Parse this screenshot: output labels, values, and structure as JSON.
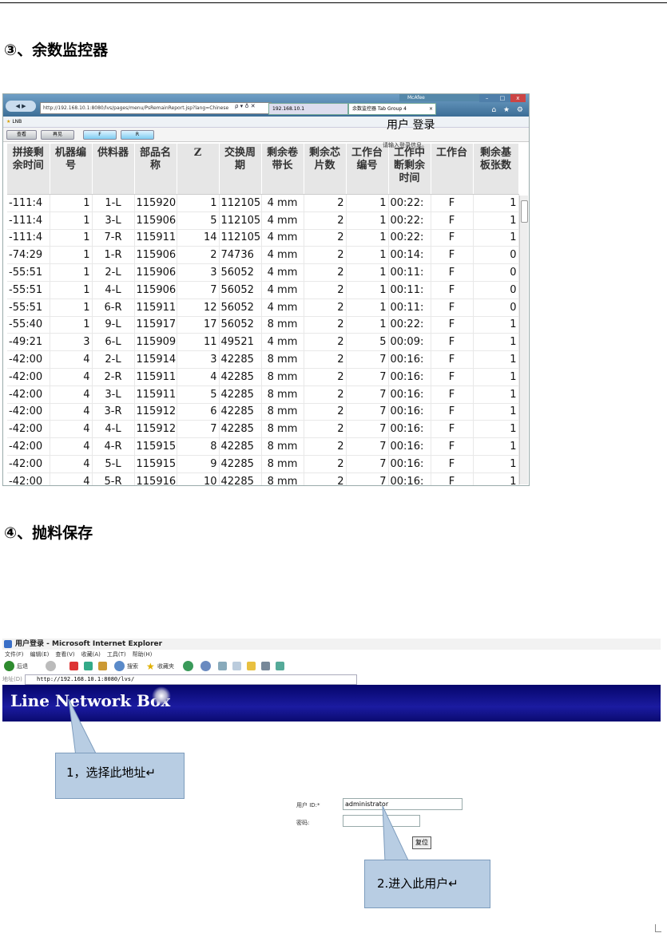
{
  "section3": {
    "heading": "③、余数监控器"
  },
  "section4": {
    "heading": "④、抛料保存"
  },
  "ie9": {
    "nav_label": "◀ ▶",
    "address": "http://192.168.10.1:8080/lvs/pages/menu/PsRemainReport.jsp?lang=Chinese",
    "address_controls": "ρ ▾ ♁ ✕",
    "tab1": "192.168.10.1",
    "tab2": "余数监控器 Tab Group 4",
    "tab_close": "×",
    "user": "McAfee",
    "favorites": "LNB",
    "icons": "⌂ ★ ⚙",
    "win_controls": {
      "min": "–",
      "max": "□",
      "close": "x"
    },
    "buttons": [
      "查看",
      "再见",
      "F",
      "R"
    ],
    "table": {
      "headers": [
        [
          "拼接剩",
          "余时间"
        ],
        [
          "机器编",
          "号"
        ],
        [
          "供料器"
        ],
        [
          "部品名",
          "称"
        ],
        [
          "Z"
        ],
        [
          "交换周",
          "期"
        ],
        [
          "剩余卷",
          "带长"
        ],
        [
          "剩余芯",
          "片数"
        ],
        [
          "工作台",
          "编号"
        ],
        [
          "工作中",
          "断剩余",
          "时间"
        ],
        [
          "工作台"
        ],
        [
          "剩余基",
          "板张数"
        ]
      ],
      "rows": [
        [
          "-111:4",
          "1",
          "1-L",
          "115920",
          "1",
          "112105",
          "4 mm",
          "2",
          "1",
          "00:22:",
          "F",
          "1"
        ],
        [
          "-111:4",
          "1",
          "3-L",
          "115906",
          "5",
          "112105",
          "4 mm",
          "2",
          "1",
          "00:22:",
          "F",
          "1"
        ],
        [
          "-111:4",
          "1",
          "7-R",
          "115911",
          "14",
          "112105",
          "4 mm",
          "2",
          "1",
          "00:22:",
          "F",
          "1"
        ],
        [
          "-74:29",
          "1",
          "1-R",
          "115906",
          "2",
          "74736",
          "4 mm",
          "2",
          "1",
          "00:14:",
          "F",
          "0"
        ],
        [
          "-55:51",
          "1",
          "2-L",
          "115906",
          "3",
          "56052",
          "4 mm",
          "2",
          "1",
          "00:11:",
          "F",
          "0"
        ],
        [
          "-55:51",
          "1",
          "4-L",
          "115906",
          "7",
          "56052",
          "4 mm",
          "2",
          "1",
          "00:11:",
          "F",
          "0"
        ],
        [
          "-55:51",
          "1",
          "6-R",
          "115911",
          "12",
          "56052",
          "4 mm",
          "2",
          "1",
          "00:11:",
          "F",
          "0"
        ],
        [
          "-55:40",
          "1",
          "9-L",
          "115917",
          "17",
          "56052",
          "8 mm",
          "2",
          "1",
          "00:22:",
          "F",
          "1"
        ],
        [
          "-49:21",
          "3",
          "6-L",
          "115909",
          "11",
          "49521",
          "4 mm",
          "2",
          "5",
          "00:09:",
          "F",
          "1"
        ],
        [
          "-42:00",
          "4",
          "2-L",
          "115914",
          "3",
          "42285",
          "8 mm",
          "2",
          "7",
          "00:16:",
          "F",
          "1"
        ],
        [
          "-42:00",
          "4",
          "2-R",
          "115911",
          "4",
          "42285",
          "8 mm",
          "2",
          "7",
          "00:16:",
          "F",
          "1"
        ],
        [
          "-42:00",
          "4",
          "3-L",
          "115911",
          "5",
          "42285",
          "8 mm",
          "2",
          "7",
          "00:16:",
          "F",
          "1"
        ],
        [
          "-42:00",
          "4",
          "3-R",
          "115912",
          "6",
          "42285",
          "8 mm",
          "2",
          "7",
          "00:16:",
          "F",
          "1"
        ],
        [
          "-42:00",
          "4",
          "4-L",
          "115912",
          "7",
          "42285",
          "8 mm",
          "2",
          "7",
          "00:16:",
          "F",
          "1"
        ],
        [
          "-42:00",
          "4",
          "4-R",
          "115915",
          "8",
          "42285",
          "8 mm",
          "2",
          "7",
          "00:16:",
          "F",
          "1"
        ],
        [
          "-42:00",
          "4",
          "5-L",
          "115915",
          "9",
          "42285",
          "8 mm",
          "2",
          "7",
          "00:16:",
          "F",
          "1"
        ],
        [
          "-42:00",
          "4",
          "5-R",
          "115916",
          "10",
          "42285",
          "8 mm",
          "2",
          "7",
          "00:16:",
          "F",
          "1"
        ]
      ]
    }
  },
  "ie6": {
    "title": "用户登录 - Microsoft Internet Explorer",
    "menu": [
      "文件(F)",
      "编辑(E)",
      "查看(V)",
      "收藏(A)",
      "工具(T)",
      "帮助(H)"
    ],
    "toolbar": {
      "back": "后退",
      "search": "搜索",
      "favorites": "收藏夹"
    },
    "address_label": "地址(D)",
    "address": "http://192.168.10.1:8080/lvs/",
    "banner_title": "Line Network Box",
    "login": {
      "title": "用户 登录",
      "subtitle": "请输入登录信息。",
      "user_label": "用户 ID:*",
      "user_value": "administrator",
      "password_label": "密码:",
      "reset_button": "复位"
    },
    "callout1": "1，选择此地址↵",
    "callout2": "2.进入此用户↵"
  }
}
